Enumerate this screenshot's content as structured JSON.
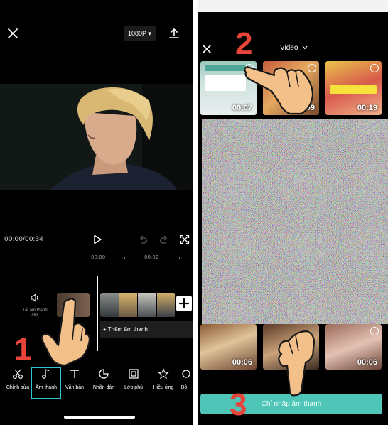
{
  "left_screen": {
    "resolution_label": "1080P ▾",
    "timecode": "00:00/00:34",
    "ruler": {
      "mark_start": "00:00",
      "mark_mid": "00:02"
    },
    "mute_label": "Tắt âm thanh clip",
    "add_audio_label": "+ Thêm âm thanh",
    "toolbar": {
      "items": [
        {
          "label": "Chỉnh sửa",
          "icon": "scissors-icon"
        },
        {
          "label": "Âm thanh",
          "icon": "music-note-icon",
          "active": true
        },
        {
          "label": "Văn bản",
          "icon": "text-icon"
        },
        {
          "label": "Nhãn dán",
          "icon": "sticker-icon"
        },
        {
          "label": "Lớp phủ",
          "icon": "overlay-icon"
        },
        {
          "label": "Hiệu ứng",
          "icon": "effects-star-icon"
        },
        {
          "label": "Bộ",
          "icon": "filter-icon"
        }
      ]
    }
  },
  "right_screen": {
    "title": "Video",
    "thumbnails_top": [
      "00:07",
      "00:09",
      "00:19"
    ],
    "thumbnails_bottom": [
      "00:06",
      "",
      "00:06"
    ],
    "import_button": "Chỉ nhập âm thanh"
  },
  "steps": {
    "one": "1",
    "two": "2",
    "three": "3"
  },
  "colors": {
    "accent": "#2ec4d6",
    "button_teal": "#4ec5b6",
    "step_red": "#e9443a"
  }
}
